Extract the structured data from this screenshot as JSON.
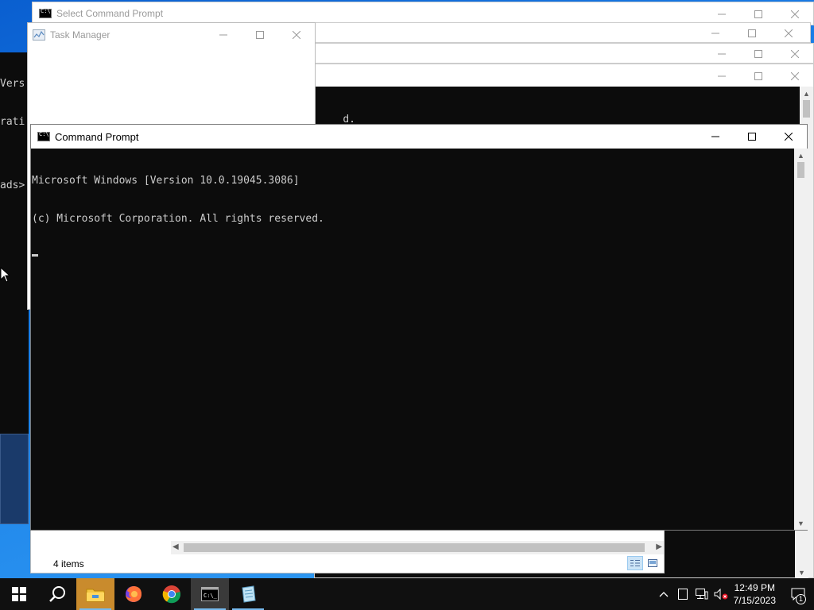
{
  "windows": {
    "select_cmd": {
      "title": "Select Command Prompt"
    },
    "task_manager": {
      "title": "Task Manager"
    },
    "back_console": {
      "partial_text": "d."
    },
    "left_console": {
      "lines": [
        "Vers",
        "rati",
        "",
        "ads>"
      ]
    },
    "main_cmd": {
      "title": "Command Prompt",
      "lines": [
        "Microsoft Windows [Version 10.0.19045.3086]",
        "(c) Microsoft Corporation. All rights reserved."
      ]
    },
    "explorer": {
      "status": "4 items"
    }
  },
  "taskbar": {
    "apps": [
      "start",
      "search",
      "file-explorer",
      "firefox",
      "chrome",
      "command-prompt",
      "notepad"
    ],
    "active": "command-prompt"
  },
  "tray": {
    "time": "12:49 PM",
    "date": "7/15/2023",
    "notification_count": "1"
  }
}
